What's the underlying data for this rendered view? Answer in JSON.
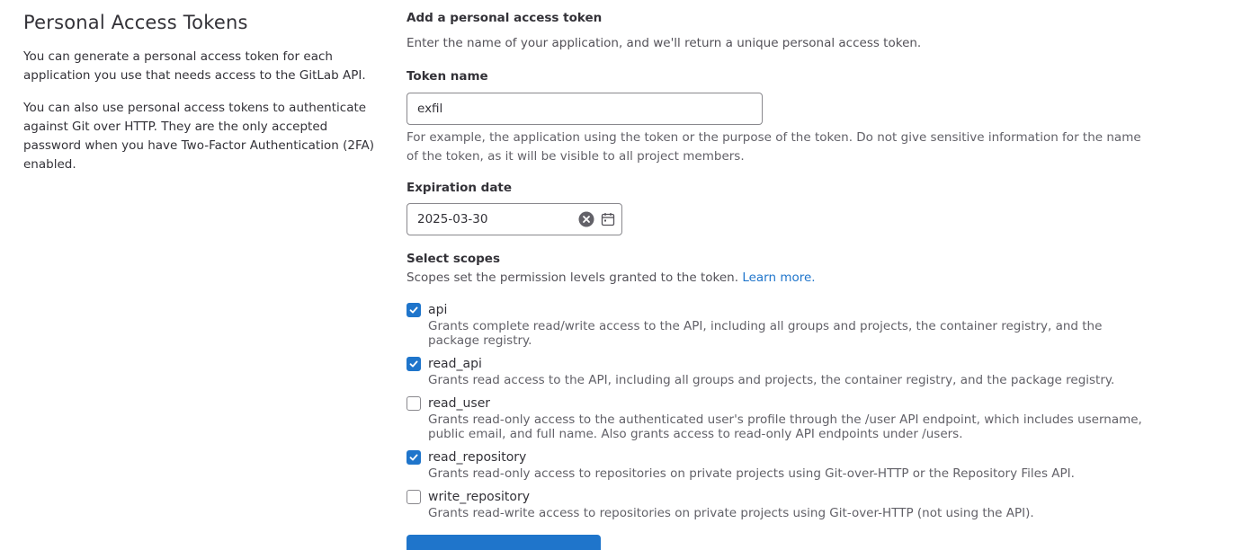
{
  "intro": {
    "title": "Personal Access Tokens",
    "paragraph1": "You can generate a personal access token for each application you use that needs access to the GitLab API.",
    "paragraph2": "You can also use personal access tokens to authenticate against Git over HTTP. They are the only accepted password when you have Two-Factor Authentication (2FA) enabled."
  },
  "form": {
    "heading": "Add a personal access token",
    "subheading": "Enter the name of your application, and we'll return a unique personal access token.",
    "token_name_label": "Token name",
    "token_name_value": "exfil",
    "token_name_help": "For example, the application using the token or the purpose of the token. Do not give sensitive information for the name of the token, as it will be visible to all project members.",
    "expiration_label": "Expiration date",
    "expiration_value": "2025-03-30",
    "scopes_label": "Select scopes",
    "scopes_help": "Scopes set the permission levels granted to the token.",
    "scopes_link": "Learn more."
  },
  "scopes": [
    {
      "name": "api",
      "checked": true,
      "description": "Grants complete read/write access to the API, including all groups and projects, the container registry, and the package registry."
    },
    {
      "name": "read_api",
      "checked": true,
      "description": "Grants read access to the API, including all groups and projects, the container registry, and the package registry."
    },
    {
      "name": "read_user",
      "checked": false,
      "description": "Grants read-only access to the authenticated user's profile through the /user API endpoint, which includes username, public email, and full name. Also grants access to read-only API endpoints under /users."
    },
    {
      "name": "read_repository",
      "checked": true,
      "description": "Grants read-only access to repositories on private projects using Git-over-HTTP or the Repository Files API."
    },
    {
      "name": "write_repository",
      "checked": false,
      "description": "Grants read-write access to repositories on private projects using Git-over-HTTP (not using the API)."
    }
  ],
  "colors": {
    "accent": "#1f75cb",
    "text": "#333238",
    "muted": "#626168"
  }
}
